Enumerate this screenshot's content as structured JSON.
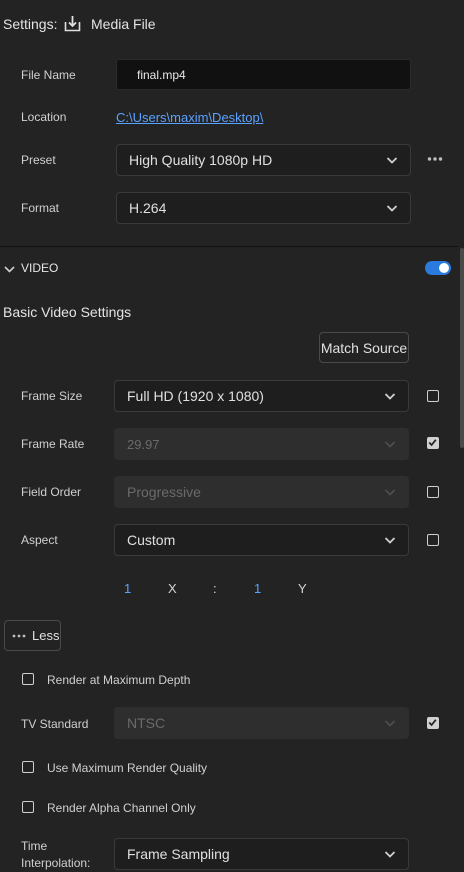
{
  "header": {
    "settings_label": "Settings:",
    "media_file_label": "Media File",
    "icon": "export-download-icon"
  },
  "file": {
    "name_label": "File Name",
    "name_value": "final.mp4",
    "location_label": "Location",
    "location_value": "C:\\Users\\maxim\\Desktop\\",
    "preset_label": "Preset",
    "preset_value": "High Quality 1080p HD",
    "format_label": "Format",
    "format_value": "H.264"
  },
  "video": {
    "section_label": "VIDEO",
    "toggle_on": true,
    "basic_title": "Basic Video Settings",
    "match_source_label": "Match Source",
    "frame_size_label": "Frame Size",
    "frame_size_value": "Full HD (1920 x 1080)",
    "frame_size_checked": false,
    "frame_rate_label": "Frame Rate",
    "frame_rate_value": "29.97",
    "frame_rate_checked": true,
    "field_order_label": "Field Order",
    "field_order_value": "Progressive",
    "field_order_checked": false,
    "aspect_label": "Aspect",
    "aspect_value": "Custom",
    "aspect_checked": false,
    "aspect_x_value": "1",
    "aspect_x_label": "X",
    "aspect_sep": ":",
    "aspect_y_value": "1",
    "aspect_y_label": "Y",
    "less_label": "Less",
    "render_max_depth_label": "Render at Maximum Depth",
    "tv_standard_label": "TV Standard",
    "tv_standard_value": "NTSC",
    "tv_standard_checked": true,
    "max_quality_label": "Use Maximum Render Quality",
    "alpha_only_label": "Render Alpha Channel Only",
    "time_interp_label_1": "Time",
    "time_interp_label_2": "Interpolation:",
    "time_interp_value": "Frame Sampling"
  },
  "colors": {
    "accent": "#2b7bdf",
    "link": "#5aa2ff",
    "background": "#232323"
  }
}
